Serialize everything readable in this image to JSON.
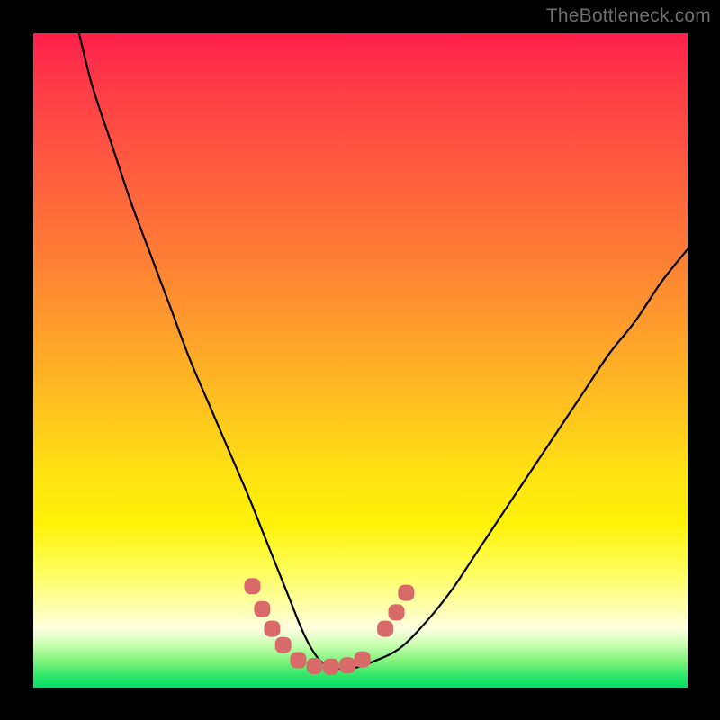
{
  "watermark": "TheBottleneck.com",
  "colors": {
    "frame": "#000000",
    "curve_stroke": "#000000",
    "marker_fill": "#d86a6a",
    "gradient_top": "#ff1f4b",
    "gradient_bottom": "#00de66"
  },
  "chart_data": {
    "type": "line",
    "title": "",
    "xlabel": "",
    "ylabel": "",
    "xlim": [
      0,
      100
    ],
    "ylim": [
      0,
      100
    ],
    "grid": false,
    "legend": false,
    "series": [
      {
        "name": "bottleneck-curve",
        "x": [
          7,
          9,
          12,
          15,
          18,
          21,
          24,
          27,
          30,
          33,
          35,
          37,
          39,
          41,
          42.5,
          44,
          46,
          49,
          52,
          56,
          60,
          64,
          68,
          72,
          76,
          80,
          84,
          88,
          92,
          96,
          100
        ],
        "y": [
          100,
          92,
          83,
          74,
          66,
          58,
          50,
          43,
          36,
          29,
          24,
          19,
          14,
          9,
          6,
          4,
          3,
          3,
          4,
          6,
          10,
          15,
          21,
          27,
          33,
          39,
          45,
          51,
          56,
          62,
          67
        ]
      }
    ],
    "markers": [
      {
        "name": "highlight-points",
        "shape": "rounded-square",
        "points": [
          {
            "x": 33.5,
            "y": 15.5
          },
          {
            "x": 35.0,
            "y": 12.0
          },
          {
            "x": 36.5,
            "y": 9.0
          },
          {
            "x": 38.2,
            "y": 6.5
          },
          {
            "x": 40.5,
            "y": 4.2
          },
          {
            "x": 43.0,
            "y": 3.3
          },
          {
            "x": 45.5,
            "y": 3.2
          },
          {
            "x": 48.0,
            "y": 3.4
          },
          {
            "x": 50.3,
            "y": 4.3
          },
          {
            "x": 53.8,
            "y": 9.0
          },
          {
            "x": 55.5,
            "y": 11.5
          },
          {
            "x": 57.0,
            "y": 14.5
          }
        ]
      }
    ]
  }
}
